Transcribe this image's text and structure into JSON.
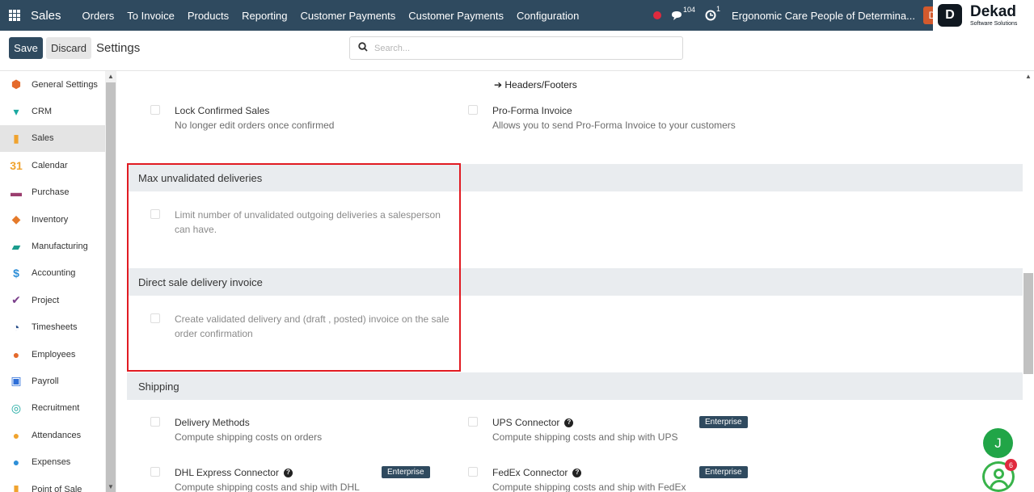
{
  "navbar": {
    "app_name": "Sales",
    "menu": [
      "Orders",
      "To Invoice",
      "Products",
      "Reporting",
      "Customer Payments",
      "Customer Payments",
      "Configuration"
    ],
    "chat_count": "104",
    "activity_count": "1",
    "company": "Ergonomic Care People of Determina...",
    "user_initial": "D",
    "logo": {
      "mark": "D",
      "name": "Dekad",
      "tagline": "Software Solutions"
    }
  },
  "control": {
    "save_label": "Save",
    "discard_label": "Discard",
    "title": "Settings",
    "search_placeholder": "Search..."
  },
  "sidebar": {
    "items": [
      {
        "label": "General Settings",
        "icon": "general-settings-icon",
        "color": "#e46a2c"
      },
      {
        "label": "CRM",
        "icon": "crm-icon",
        "color": "#1aa8a0"
      },
      {
        "label": "Sales",
        "icon": "sales-icon",
        "color": "#f0a32e",
        "active": true
      },
      {
        "label": "Calendar",
        "icon": "calendar-icon",
        "color": "#f0a32e"
      },
      {
        "label": "Purchase",
        "icon": "purchase-icon",
        "color": "#9b3e6f"
      },
      {
        "label": "Inventory",
        "icon": "inventory-icon",
        "color": "#e57a2a"
      },
      {
        "label": "Manufacturing",
        "icon": "manufacturing-icon",
        "color": "#1b9c8d"
      },
      {
        "label": "Accounting",
        "icon": "accounting-icon",
        "color": "#2e8fd8"
      },
      {
        "label": "Project",
        "icon": "project-icon",
        "color": "#7a3e8a"
      },
      {
        "label": "Timesheets",
        "icon": "timesheets-icon",
        "color": "#2a4f8a"
      },
      {
        "label": "Employees",
        "icon": "employees-icon",
        "color": "#e46a2c"
      },
      {
        "label": "Payroll",
        "icon": "payroll-icon",
        "color": "#2e6fd8"
      },
      {
        "label": "Recruitment",
        "icon": "recruitment-icon",
        "color": "#1aa8a0"
      },
      {
        "label": "Attendances",
        "icon": "attendances-icon",
        "color": "#f0a32e"
      },
      {
        "label": "Expenses",
        "icon": "expenses-icon",
        "color": "#2e8fd8"
      },
      {
        "label": "Point of Sale",
        "icon": "point-of-sale-icon",
        "color": "#f0a32e"
      }
    ]
  },
  "main": {
    "headers_footers_link": "Headers/Footers",
    "lock_confirmed": {
      "title": "Lock Confirmed Sales",
      "desc": "No longer edit orders once confirmed"
    },
    "pro_forma": {
      "title": "Pro-Forma Invoice",
      "desc": "Allows you to send Pro-Forma Invoice to your customers"
    },
    "max_unvalidated": {
      "heading": "Max unvalidated deliveries",
      "desc_line1": "Limit number of unvalidated outgoing deliveries a salesperson",
      "desc_line2": "can have."
    },
    "direct_sale": {
      "heading": "Direct sale delivery invoice",
      "desc_line1": "Create validated delivery and (draft , posted) invoice on the sale",
      "desc_line2": "order confirmation"
    },
    "shipping": {
      "heading": "Shipping",
      "delivery_methods": {
        "title": "Delivery Methods",
        "desc": "Compute shipping costs on orders"
      },
      "ups": {
        "title": "UPS Connector",
        "desc": "Compute shipping costs and ship with UPS",
        "badge": "Enterprise"
      },
      "dhl": {
        "title": "DHL Express Connector",
        "desc": "Compute shipping costs and ship with DHL",
        "badge": "Enterprise"
      },
      "fedex": {
        "title": "FedEx Connector",
        "desc": "Compute shipping costs and ship with FedEx",
        "badge": "Enterprise"
      }
    }
  },
  "fab": {
    "initial": "J",
    "help_badge": "6"
  },
  "colors": {
    "navbar": "#2f4a5f",
    "highlight": "#e11b22",
    "fab_green": "#21a547"
  }
}
